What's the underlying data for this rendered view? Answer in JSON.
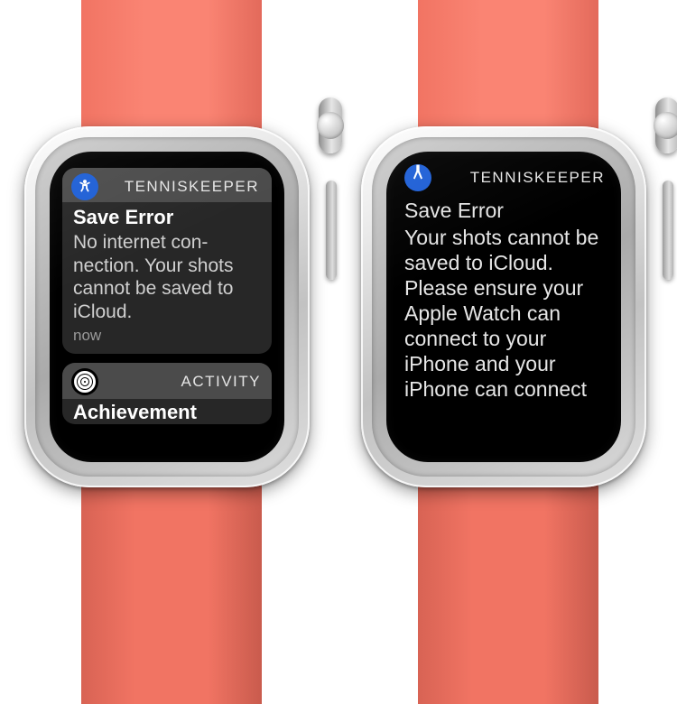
{
  "colors": {
    "strap": "#f17463",
    "app_icon_bg": "#1e5fd6"
  },
  "left": {
    "notifications": [
      {
        "app_name": "TENNISKEEPER",
        "title": "Save Error",
        "body": "No internet con­nection. Your shots cannot be saved to iCloud.",
        "timestamp": "now"
      },
      {
        "app_name": "ACTIVITY",
        "title_peek": "Achievement"
      }
    ]
  },
  "right": {
    "app_name": "TENNISKEEPER",
    "title": "Save Error",
    "body": "Your shots cannot be saved to iCloud. Please ensure your Apple Watch can connect to your iPhone and your iPhone can connect"
  }
}
